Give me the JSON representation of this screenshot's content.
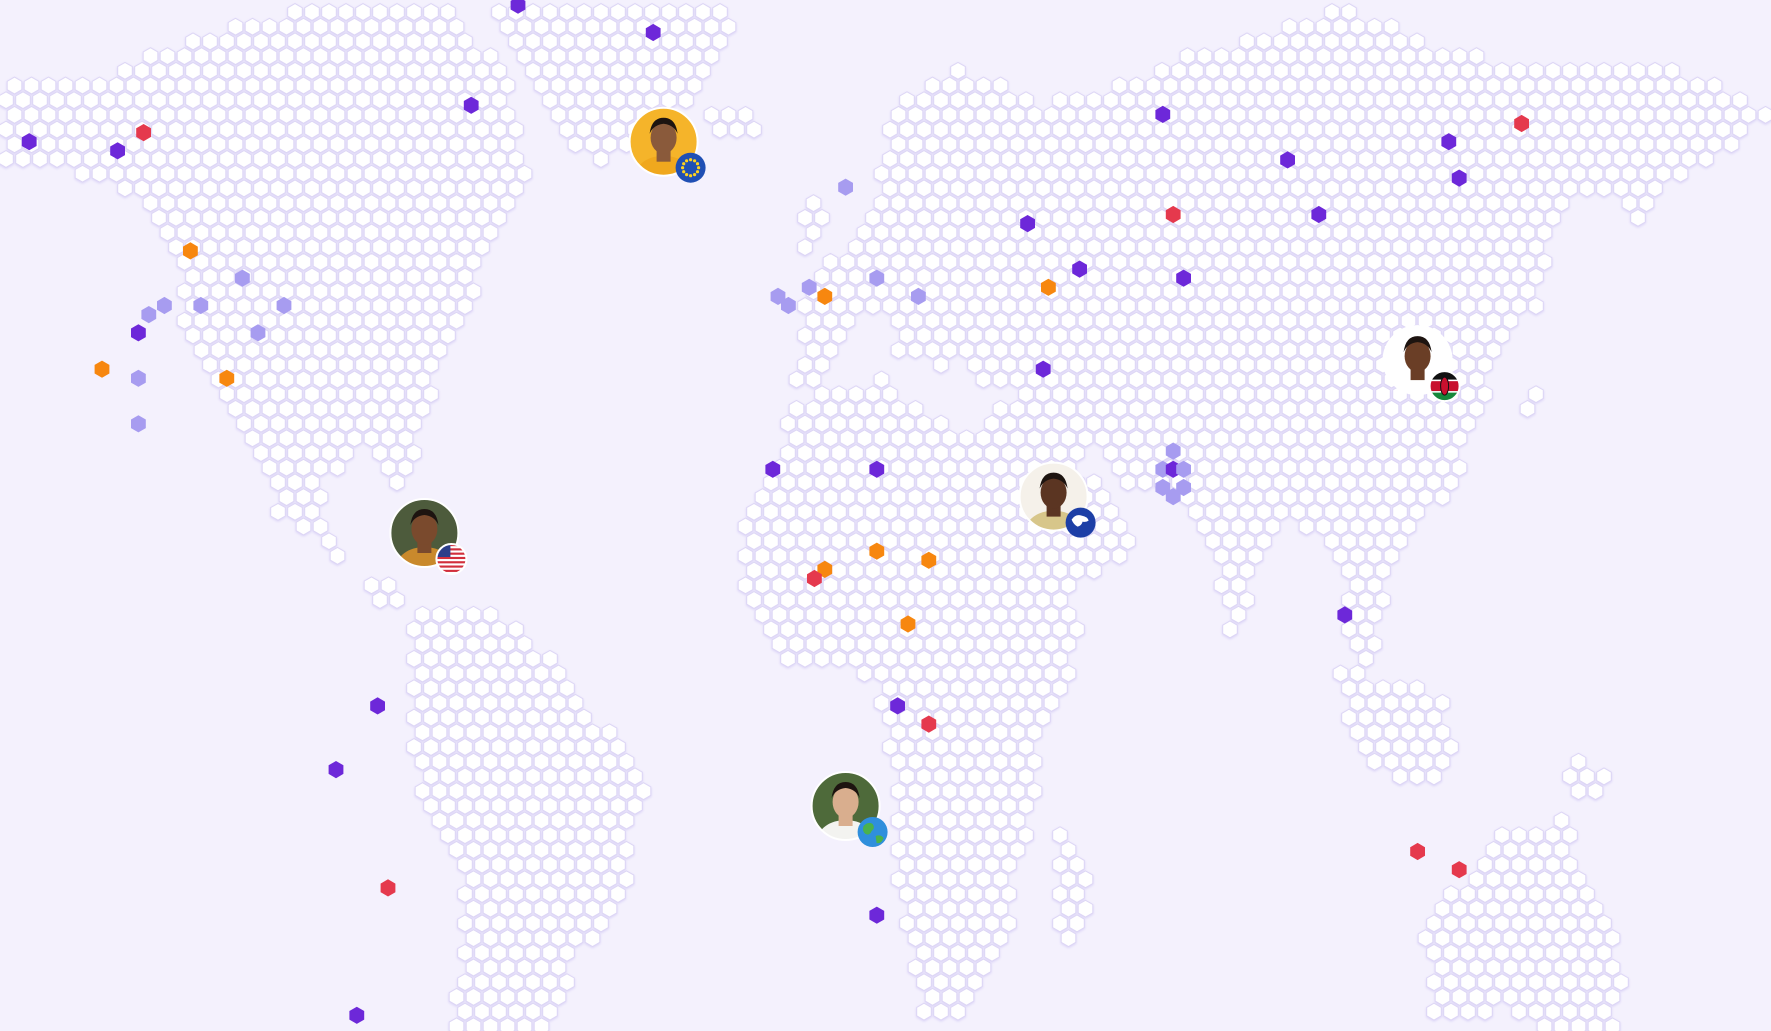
{
  "colors": {
    "background": "#f4f1fd",
    "hex_fill": "#ffffff",
    "hex_stroke": "#ddd6f5",
    "marker_purple": "#6d28d9",
    "marker_lavender": "#a79cf0",
    "marker_orange": "#f7870f",
    "marker_red": "#e5394d"
  },
  "map": {
    "style": "hexagon-dot world map",
    "markers": [
      {
        "lon": -60,
        "lat": 78,
        "kind": "purple"
      },
      {
        "lon": -34,
        "lat": 75,
        "kind": "purple"
      },
      {
        "lon": -69,
        "lat": 67,
        "kind": "purple"
      },
      {
        "lon": -154,
        "lat": 63,
        "kind": "purple"
      },
      {
        "lon": -137,
        "lat": 62,
        "kind": "purple"
      },
      {
        "lon": -132,
        "lat": 64,
        "kind": "red"
      },
      {
        "lon": -123,
        "lat": 51,
        "kind": "orange"
      },
      {
        "lon": -113,
        "lat": 48,
        "kind": "lavender"
      },
      {
        "lon": -128,
        "lat": 45,
        "kind": "lavender"
      },
      {
        "lon": -121,
        "lat": 45,
        "kind": "lavender"
      },
      {
        "lon": -105,
        "lat": 45,
        "kind": "lavender"
      },
      {
        "lon": -131,
        "lat": 44,
        "kind": "lavender"
      },
      {
        "lon": -110,
        "lat": 42,
        "kind": "lavender"
      },
      {
        "lon": -133,
        "lat": 42,
        "kind": "purple"
      },
      {
        "lon": -140,
        "lat": 38,
        "kind": "orange"
      },
      {
        "lon": -133,
        "lat": 37,
        "kind": "lavender"
      },
      {
        "lon": -116,
        "lat": 37,
        "kind": "orange"
      },
      {
        "lon": -133,
        "lat": 32,
        "kind": "lavender"
      },
      {
        "lon": 3,
        "lat": 58,
        "kind": "lavender"
      },
      {
        "lon": -4,
        "lat": 47,
        "kind": "lavender"
      },
      {
        "lon": -8,
        "lat": 45,
        "kind": "lavender"
      },
      {
        "lon": -10,
        "lat": 46,
        "kind": "lavender"
      },
      {
        "lon": -1,
        "lat": 46,
        "kind": "orange"
      },
      {
        "lon": 9,
        "lat": 48,
        "kind": "lavender"
      },
      {
        "lon": 17,
        "lat": 46,
        "kind": "lavender"
      },
      {
        "lon": 38,
        "lat": 54,
        "kind": "purple"
      },
      {
        "lon": 48,
        "lat": 49,
        "kind": "purple"
      },
      {
        "lon": 42,
        "lat": 47,
        "kind": "orange"
      },
      {
        "lon": 41,
        "lat": 38,
        "kind": "purple"
      },
      {
        "lon": 64,
        "lat": 66,
        "kind": "purple"
      },
      {
        "lon": 66,
        "lat": 55,
        "kind": "red"
      },
      {
        "lon": 68,
        "lat": 48,
        "kind": "purple"
      },
      {
        "lon": 88,
        "lat": 61,
        "kind": "purple"
      },
      {
        "lon": 94,
        "lat": 55,
        "kind": "purple"
      },
      {
        "lon": 119,
        "lat": 63,
        "kind": "purple"
      },
      {
        "lon": 121,
        "lat": 59,
        "kind": "purple"
      },
      {
        "lon": 133,
        "lat": 65,
        "kind": "red"
      },
      {
        "lon": 66,
        "lat": 29,
        "kind": "lavender"
      },
      {
        "lon": 64,
        "lat": 27,
        "kind": "lavender"
      },
      {
        "lon": 66,
        "lat": 27,
        "kind": "purple"
      },
      {
        "lon": 68,
        "lat": 27,
        "kind": "lavender"
      },
      {
        "lon": 64,
        "lat": 25,
        "kind": "lavender"
      },
      {
        "lon": 68,
        "lat": 25,
        "kind": "lavender"
      },
      {
        "lon": 66,
        "lat": 24,
        "kind": "lavender"
      },
      {
        "lon": -11,
        "lat": 27,
        "kind": "purple"
      },
      {
        "lon": 9,
        "lat": 27,
        "kind": "purple"
      },
      {
        "lon": 9,
        "lat": 18,
        "kind": "orange"
      },
      {
        "lon": 19,
        "lat": 17,
        "kind": "orange"
      },
      {
        "lon": -1,
        "lat": 16,
        "kind": "orange"
      },
      {
        "lon": -3,
        "lat": 15,
        "kind": "red"
      },
      {
        "lon": 15,
        "lat": 10,
        "kind": "orange"
      },
      {
        "lon": 13,
        "lat": 1,
        "kind": "purple"
      },
      {
        "lon": 19,
        "lat": -1,
        "kind": "red"
      },
      {
        "lon": 9,
        "lat": -22,
        "kind": "purple"
      },
      {
        "lon": 99,
        "lat": 11,
        "kind": "purple"
      },
      {
        "lon": -87,
        "lat": 1,
        "kind": "purple"
      },
      {
        "lon": -95,
        "lat": -6,
        "kind": "purple"
      },
      {
        "lon": -85,
        "lat": -19,
        "kind": "red"
      },
      {
        "lon": -91,
        "lat": -33,
        "kind": "purple"
      },
      {
        "lon": 113,
        "lat": -15,
        "kind": "red"
      },
      {
        "lon": 121,
        "lat": -17,
        "kind": "red"
      }
    ],
    "avatars": [
      {
        "name": "avatar-eu-person",
        "lon": -32,
        "lat": 63,
        "skin": "#8a5a3b",
        "shirt": "#f0a81e",
        "bg": "#f5b42a",
        "badge": "eu-flag-badge"
      },
      {
        "name": "avatar-us-person",
        "lon": -78,
        "lat": 20,
        "skin": "#7a4a2d",
        "shirt": "#c9892c",
        "bg": "#4d5b3c",
        "badge": "us-flag-badge"
      },
      {
        "name": "avatar-africa-person",
        "lon": 3,
        "lat": -10,
        "skin": "#d9ae8e",
        "shirt": "#f3f3f0",
        "bg": "#4e6a3a",
        "badge": "earth-globe-badge"
      },
      {
        "name": "avatar-asia-person",
        "lon": 43,
        "lat": 24,
        "skin": "#5b3522",
        "shirt": "#d7c68a",
        "bg": "#f5f1ea",
        "badge": "asia-map-badge"
      },
      {
        "name": "avatar-kenya-person",
        "lon": 113,
        "lat": 39,
        "skin": "#6a3e26",
        "shirt": "#ffffff",
        "bg": "#ffffff",
        "badge": "kenya-flag-badge"
      }
    ]
  }
}
